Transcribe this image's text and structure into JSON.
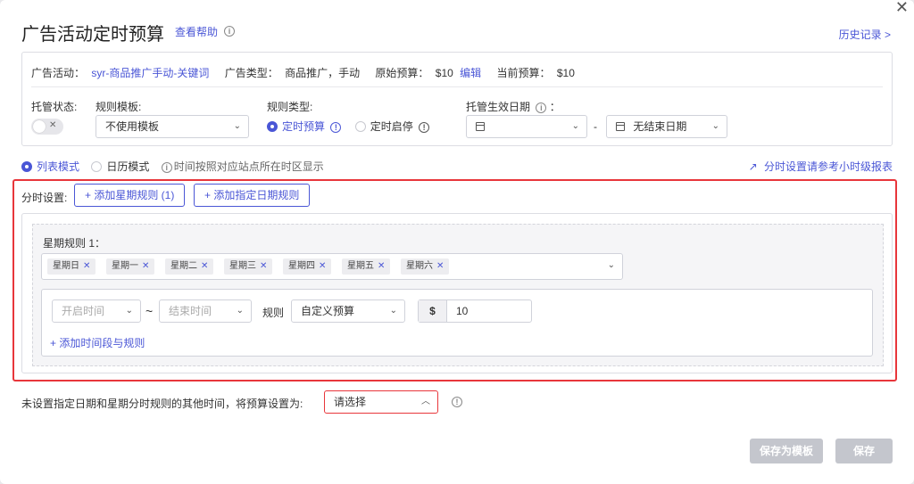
{
  "header": {
    "title": "广告活动定时预算",
    "help_link": "查看帮助",
    "history_link": "历史记录 >",
    "close": "✕"
  },
  "info": {
    "campaign_label": "广告活动：",
    "campaign_value": "syr-商品推广手动-关键词",
    "type_label": "广告类型：",
    "type_value": "商品推广，手动",
    "orig_budget_label": "原始预算：",
    "orig_budget_value": "$10",
    "edit_link": "编辑",
    "cur_budget_label": "当前预算：",
    "cur_budget_value": "$10"
  },
  "fields": {
    "hosting_status_label": "托管状态:",
    "toggle_off": "✕",
    "template_label": "规则模板:",
    "template_value": "不使用模板",
    "rule_type_label": "规则类型:",
    "rule_type_opt1": "定时预算",
    "rule_type_opt2": "定时启停",
    "effective_date_label": "托管生效日期",
    "date_end_value": "无结束日期",
    "date_sep": "-"
  },
  "mode": {
    "list_mode": "列表模式",
    "calendar_mode": "日历模式",
    "tz_note": "时间按照对应站点所在时区显示",
    "report_link": "分时设置请参考小时级报表"
  },
  "schedule": {
    "label": "分时设置:",
    "add_week_rule": "+ 添加星期规则 (1)",
    "add_date_rule": "+ 添加指定日期规则",
    "week_rule_title": "星期规则 1：",
    "days": [
      "星期日",
      "星期一",
      "星期二",
      "星期三",
      "星期四",
      "星期五",
      "星期六"
    ],
    "start_time_placeholder": "开启时间",
    "tilde": "~",
    "end_time_placeholder": "结束时间",
    "rule_label": "规则",
    "rule_value": "自定义预算",
    "currency": "$",
    "amount": "10",
    "add_period": "+ 添加时间段与规则"
  },
  "footer": {
    "other_time_label": "未设置指定日期和星期分时规则的其他时间，将预算设置为:",
    "other_time_placeholder": "请选择",
    "save_template": "保存为模板",
    "save": "保存"
  },
  "colors": {
    "accent": "#4a56d6",
    "highlight_border": "#e8363b",
    "disabled_button": "#c4c6cd"
  }
}
